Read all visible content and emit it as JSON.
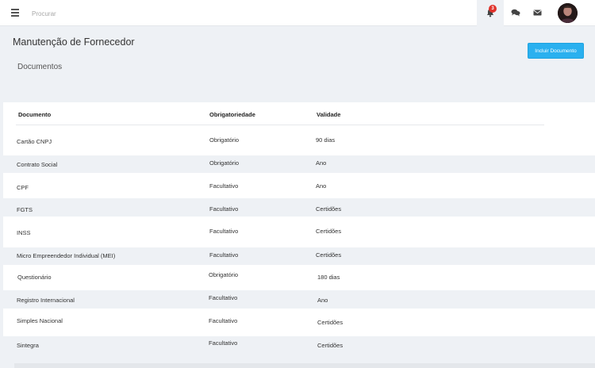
{
  "topbar": {
    "search_placeholder": "Procurar",
    "notifications_count": "3",
    "icons": [
      "menu-icon",
      "bell-icon",
      "chat-icon",
      "mail-icon"
    ]
  },
  "page": {
    "title": "Manutenção de Fornecedor",
    "add_button_label": "Incluir Documento",
    "section_title": "Documentos"
  },
  "colors": {
    "accent": "#2ab0ef",
    "badge": "#e0322b",
    "alt_row": "#eef1f5"
  },
  "table": {
    "headers": [
      "Documento",
      "Obrigatoriedade",
      "Validade"
    ],
    "rows": [
      [
        "Cartão CNPJ",
        "Obrigatório",
        "90 dias"
      ],
      [
        "Contrato Social",
        "Obrigatório",
        "Ano"
      ],
      [
        "CPF",
        "Facultativo",
        "Ano"
      ],
      [
        "FGTS",
        "Facultativo",
        "Certidões"
      ],
      [
        "INSS",
        "Facultativo",
        "Certidões"
      ],
      [
        "Micro Empreendedor Individual (MEI)",
        "Facultativo",
        "Certidões"
      ],
      [
        "Questionário",
        "Obrigatório",
        "180 dias"
      ],
      [
        "Registro Internacional",
        "Facultativo",
        "Ano"
      ],
      [
        "Simples Nacional",
        "Facultativo",
        "Certidões"
      ],
      [
        "Sintegra",
        "Facultativo",
        "Certidões"
      ]
    ]
  }
}
